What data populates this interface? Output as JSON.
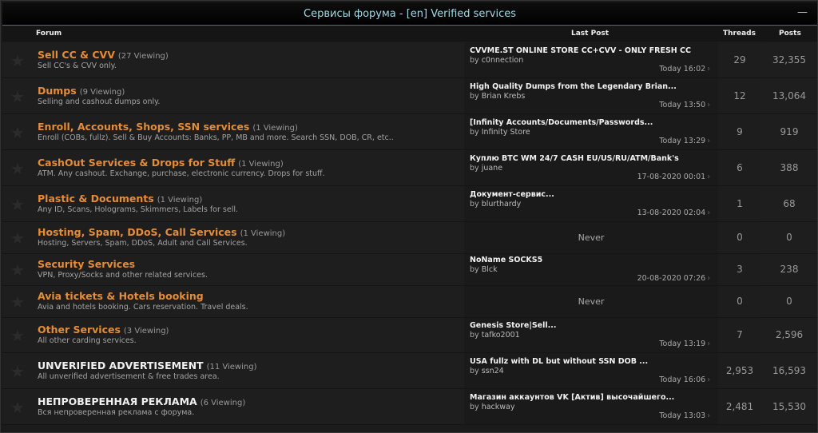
{
  "header": {
    "title": "Сервисы форума - [en] Verified services",
    "collapse": "—"
  },
  "columns": {
    "forum": "Forum",
    "last_post": "Last Post",
    "threads": "Threads",
    "posts": "Posts"
  },
  "forums": [
    {
      "name": "Sell CC & CVV",
      "viewing": "(27 Viewing)",
      "desc": "Sell CC's & CVV only.",
      "lp_title": "CVVME.ST ONLINE STORE CC+CVV - ONLY FRESH CC",
      "lp_by": "by ",
      "lp_user": "c0nnection",
      "lp_time": "Today 16:02",
      "threads": "29",
      "posts": "32,355"
    },
    {
      "name": "Dumps",
      "viewing": "(9 Viewing)",
      "desc": "Selling and cashout dumps only.",
      "lp_title": "High Quality Dumps from the Legendary Brian...",
      "lp_by": "by ",
      "lp_user": "Brian Krebs",
      "lp_time": "Today 13:50",
      "threads": "12",
      "posts": "13,064"
    },
    {
      "name": "Enroll, Accounts, Shops, SSN services",
      "viewing": "(1 Viewing)",
      "desc": "Enroll (COBs, fullz). Sell & Buy Accounts: Banks, PP, MB and more. Search SSN, DOB, CR, etc..",
      "lp_title": "[Infinity Accounts/Documents/Passwords...",
      "lp_by": "by ",
      "lp_user": "Infinity Store",
      "lp_time": "Today 13:29",
      "threads": "9",
      "posts": "919"
    },
    {
      "name": "CashOut Services & Drops for Stuff",
      "viewing": "(1 Viewing)",
      "desc": "ATM. Any cashout. Exchange, purchase, electronic currency. Drops for stuff.",
      "lp_title": "Куплю BTC WM 24/7 CASH EU/US/RU/ATM/Bank's",
      "lp_by": "by ",
      "lp_user": "juane",
      "lp_time": "17-08-2020 00:01",
      "threads": "6",
      "posts": "388"
    },
    {
      "name": "Plastic & Documents",
      "viewing": "(1 Viewing)",
      "desc": "Any ID, Scans, Holograms, Skimmers, Labels for sell.",
      "lp_title": "Документ-сервис...",
      "lp_by": "by ",
      "lp_user": "blurthardy",
      "lp_time": "13-08-2020 02:04",
      "threads": "1",
      "posts": "68"
    },
    {
      "name": "Hosting, Spam, DDoS, Call Services",
      "viewing": "(1 Viewing)",
      "desc": "Hosting, Servers, Spam, DDoS, Adult and Call Services.",
      "never": "Never",
      "threads": "0",
      "posts": "0"
    },
    {
      "name": "Security Services",
      "desc": "VPN, Proxy/Socks and other related services.",
      "lp_title": "NoName SOCKS5",
      "lp_by": "by ",
      "lp_user": "Blck",
      "lp_time": "20-08-2020 07:26",
      "threads": "3",
      "posts": "238"
    },
    {
      "name": "Avia tickets & Hotels booking",
      "desc": "Avia and hotels booking. Cars reservation. Travel deals.",
      "never": "Never",
      "threads": "0",
      "posts": "0"
    },
    {
      "name": "Other Services",
      "viewing": "(3 Viewing)",
      "desc": "All other carding services.",
      "lp_title": "Genesis Store|Sell...",
      "lp_by": "by ",
      "lp_user": "tafko2001",
      "lp_time": "Today 13:19",
      "threads": "7",
      "posts": "2,596"
    },
    {
      "name": "UNVERIFIED ADVERTISEMENT",
      "viewing": "(11 Viewing)",
      "desc": "All unverified advertisement & free trades area.",
      "lp_title": "USA fullz with DL but without SSN DOB ...",
      "lp_by": "by ",
      "lp_user": "ssn24",
      "lp_time": "Today 16:06",
      "threads": "2,953",
      "posts": "16,593",
      "white": true
    },
    {
      "name": "НЕПРОВЕРЕННАЯ РЕКЛАМА",
      "viewing": "(6 Viewing)",
      "desc": "Вся непроверенная реклама с форума.",
      "lp_title": "Магазин аккаунтов VK [Актив] высочайшего...",
      "lp_by": "by ",
      "lp_user": "hackway",
      "lp_time": "Today 13:03",
      "threads": "2,481",
      "posts": "15,530",
      "white": true
    }
  ],
  "colors": {
    "accent": "#e48c38",
    "header_text": "#9fd8e6"
  }
}
